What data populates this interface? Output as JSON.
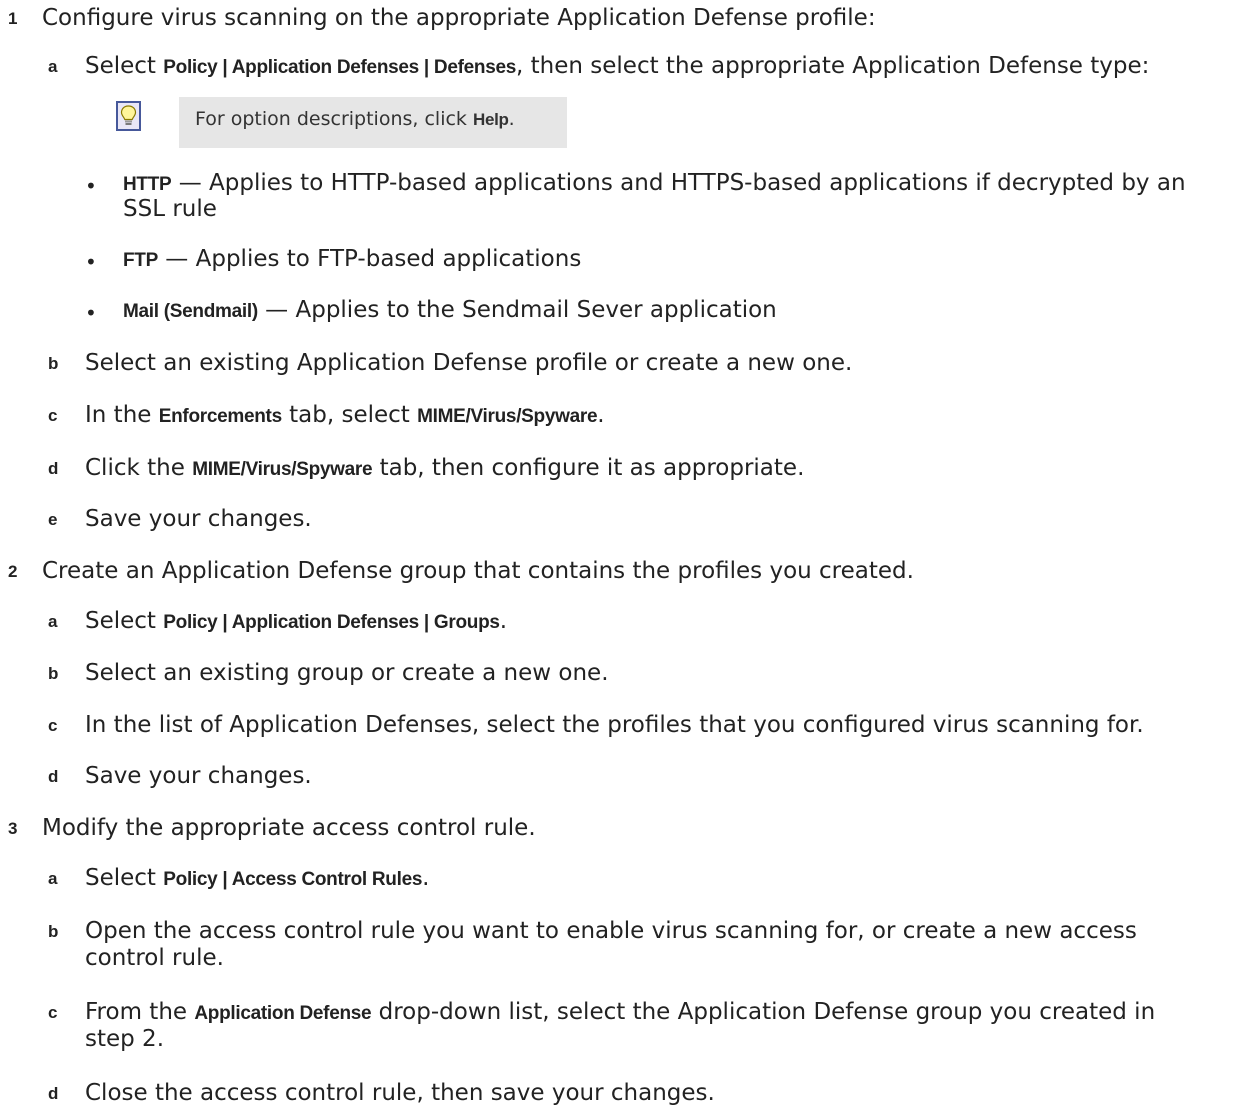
{
  "steps": [
    {
      "number": "1",
      "text": "Configure virus scanning on the appropriate Application Defense profile:"
    },
    {
      "number": "2",
      "text": "Create an Application Defense group that contains the profiles you created."
    },
    {
      "number": "3",
      "text": "Modify the appropriate access control rule."
    }
  ],
  "step1": {
    "a": {
      "letter": "a",
      "pre": "Select ",
      "ui1": "Policy",
      "sep1": " | ",
      "ui2": "Application Defenses",
      "sep2": " | ",
      "ui3": "Defenses",
      "post": ", then select the appropriate Application Defense type:"
    },
    "tip": {
      "text": "For option descriptions, click ",
      "ui": "Help",
      "post": ".",
      "icon": "lightbulb-icon"
    },
    "bullets": [
      {
        "label": "HTTP",
        "text": " — Applies to HTTP-based applications and HTTPS-based applications if decrypted by an",
        "text2": "SSL rule"
      },
      {
        "label": "FTP",
        "text": " — Applies to FTP-based applications"
      },
      {
        "label": "Mail (Sendmail)",
        "text": " — Applies to the Sendmail Sever application"
      }
    ],
    "b": {
      "letter": "b",
      "text": "Select an existing Application Defense profile or create a new one."
    },
    "c": {
      "letter": "c",
      "pre": "In the ",
      "ui1": "Enforcements",
      "mid": " tab, select ",
      "ui2": "MIME/Virus/Spyware",
      "post": "."
    },
    "d": {
      "letter": "d",
      "pre": "Click the ",
      "ui1": "MIME/Virus/Spyware",
      "post": " tab, then configure it as appropriate."
    },
    "e": {
      "letter": "e",
      "text": "Save your changes."
    }
  },
  "step2": {
    "a": {
      "letter": "a",
      "pre": "Select ",
      "ui1": "Policy",
      "sep1": " | ",
      "ui2": "Application Defenses",
      "sep2": " | ",
      "ui3": "Groups",
      "post": "."
    },
    "b": {
      "letter": "b",
      "text": "Select an existing group or create a new one."
    },
    "c": {
      "letter": "c",
      "text": "In the list of Application Defenses, select the profiles that you configured virus scanning for."
    },
    "d": {
      "letter": "d",
      "text": "Save your changes."
    }
  },
  "step3": {
    "a": {
      "letter": "a",
      "pre": "Select ",
      "ui1": "Policy",
      "sep1": " | ",
      "ui2": "Access Control Rules",
      "post": "."
    },
    "b": {
      "letter": "b",
      "text": "Open the access control rule you want to enable virus scanning for, or create a new access",
      "text2": "control rule."
    },
    "c": {
      "letter": "c",
      "pre": "From the ",
      "ui1": "Application Defense",
      "post": " drop-down list, select the Application Defense group you created in",
      "text2": "step 2."
    },
    "d": {
      "letter": "d",
      "text": "Close the access control rule, then save your changes."
    }
  }
}
